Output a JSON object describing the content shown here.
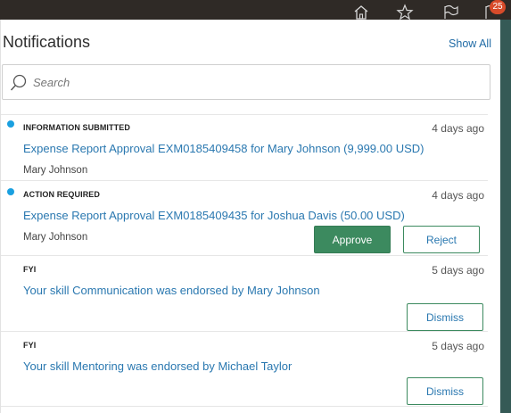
{
  "topbar": {
    "icons": [
      "home-icon",
      "favorites-star-icon",
      "flag-icon",
      "notifications-flag-icon"
    ],
    "notification_count": "25",
    "badge_color": "#d84b2a"
  },
  "panel": {
    "title": "Notifications",
    "show_all": "Show All",
    "search": {
      "placeholder": "Search",
      "value": ""
    }
  },
  "notifications": [
    {
      "type": "INFORMATION SUBMITTED",
      "time": "4 days ago",
      "title": "Expense Report Approval EXM0185409458 for Mary Johnson (9,999.00 USD)",
      "from": "Mary Johnson",
      "unread": true
    },
    {
      "type": "ACTION REQUIRED",
      "time": "4 days ago",
      "title": "Expense Report Approval EXM0185409435 for Joshua Davis (50.00 USD)",
      "from": "Mary Johnson",
      "unread": true,
      "actions": {
        "approve": "Approve",
        "reject": "Reject"
      }
    },
    {
      "type": "FYI",
      "time": "5 days ago",
      "title": "Your skill Communication was endorsed by Mary Johnson",
      "unread": false,
      "actions": {
        "dismiss": "Dismiss"
      }
    },
    {
      "type": "FYI",
      "time": "5 days ago",
      "title": "Your skill Mentoring was endorsed by Michael Taylor",
      "unread": false,
      "actions": {
        "dismiss": "Dismiss"
      }
    }
  ],
  "colors": {
    "accent": "#2a78b0",
    "primary_button": "#3c8a5f",
    "unread_dot": "#1aa0e0"
  }
}
